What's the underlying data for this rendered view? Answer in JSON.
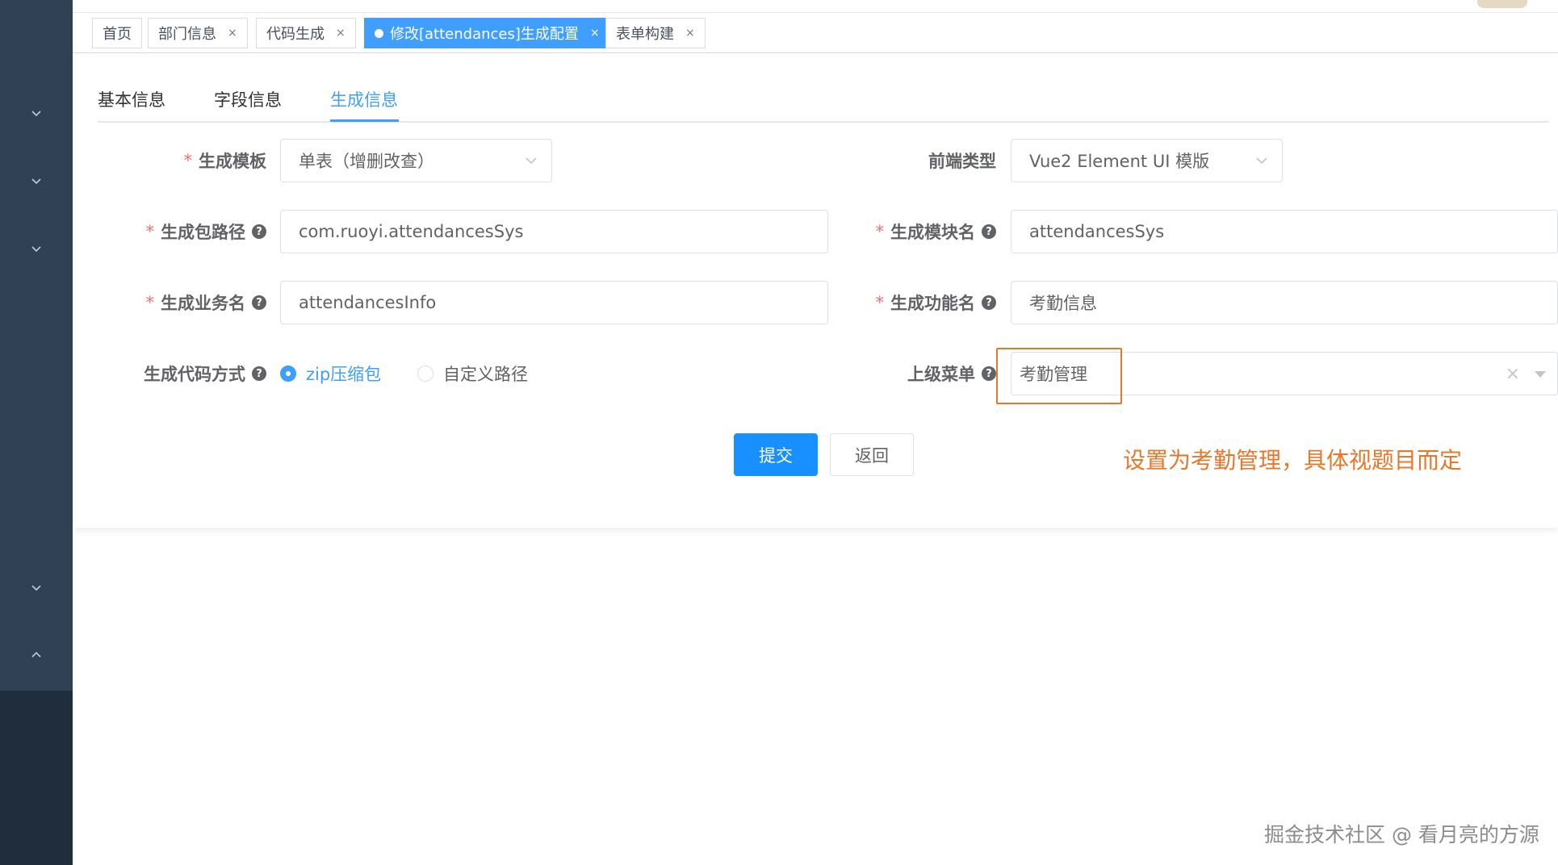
{
  "tags": [
    {
      "label": "首页",
      "closable": false,
      "active": false
    },
    {
      "label": "部门信息",
      "closable": true,
      "active": false
    },
    {
      "label": "代码生成",
      "closable": true,
      "active": false
    },
    {
      "label": "修改[attendances]生成配置",
      "closable": true,
      "active": true
    },
    {
      "label": "表单构建",
      "closable": true,
      "active": false
    }
  ],
  "tag_close_glyph": "×",
  "tabs": [
    "基本信息",
    "字段信息",
    "生成信息"
  ],
  "active_tab": "生成信息",
  "form": {
    "template": {
      "label": "生成模板",
      "required": true,
      "value": "单表（增删改查）"
    },
    "frontend": {
      "label": "前端类型",
      "required": false,
      "value": "Vue2 Element UI 模版"
    },
    "package": {
      "label": "生成包路径",
      "required": true,
      "value": "com.ruoyi.attendancesSys"
    },
    "module": {
      "label": "生成模块名",
      "required": true,
      "value": "attendancesSys"
    },
    "business": {
      "label": "生成业务名",
      "required": true,
      "value": "attendancesInfo"
    },
    "function": {
      "label": "生成功能名",
      "required": true,
      "value": "考勤信息"
    },
    "gen_type": {
      "label": "生成代码方式",
      "options": [
        "zip压缩包",
        "自定义路径"
      ],
      "selected": "zip压缩包"
    },
    "parent_menu": {
      "label": "上级菜单",
      "value": "考勤管理"
    },
    "required_mark": "*",
    "help_glyph": "?",
    "clear_glyph": "×"
  },
  "buttons": {
    "submit": "提交",
    "back": "返回"
  },
  "annotation": "设置为考勤管理，具体视题目而定",
  "watermark": "掘金技术社区 @ 看月亮的方源",
  "colors": {
    "primary": "#409eff",
    "annotation": "#e8772a",
    "sidebar": "#304156"
  },
  "sidebar": {
    "chevrons": [
      "chevron-down-icon",
      "chevron-down-icon",
      "chevron-down-icon",
      "chevron-down-icon",
      "chevron-up-icon"
    ]
  }
}
